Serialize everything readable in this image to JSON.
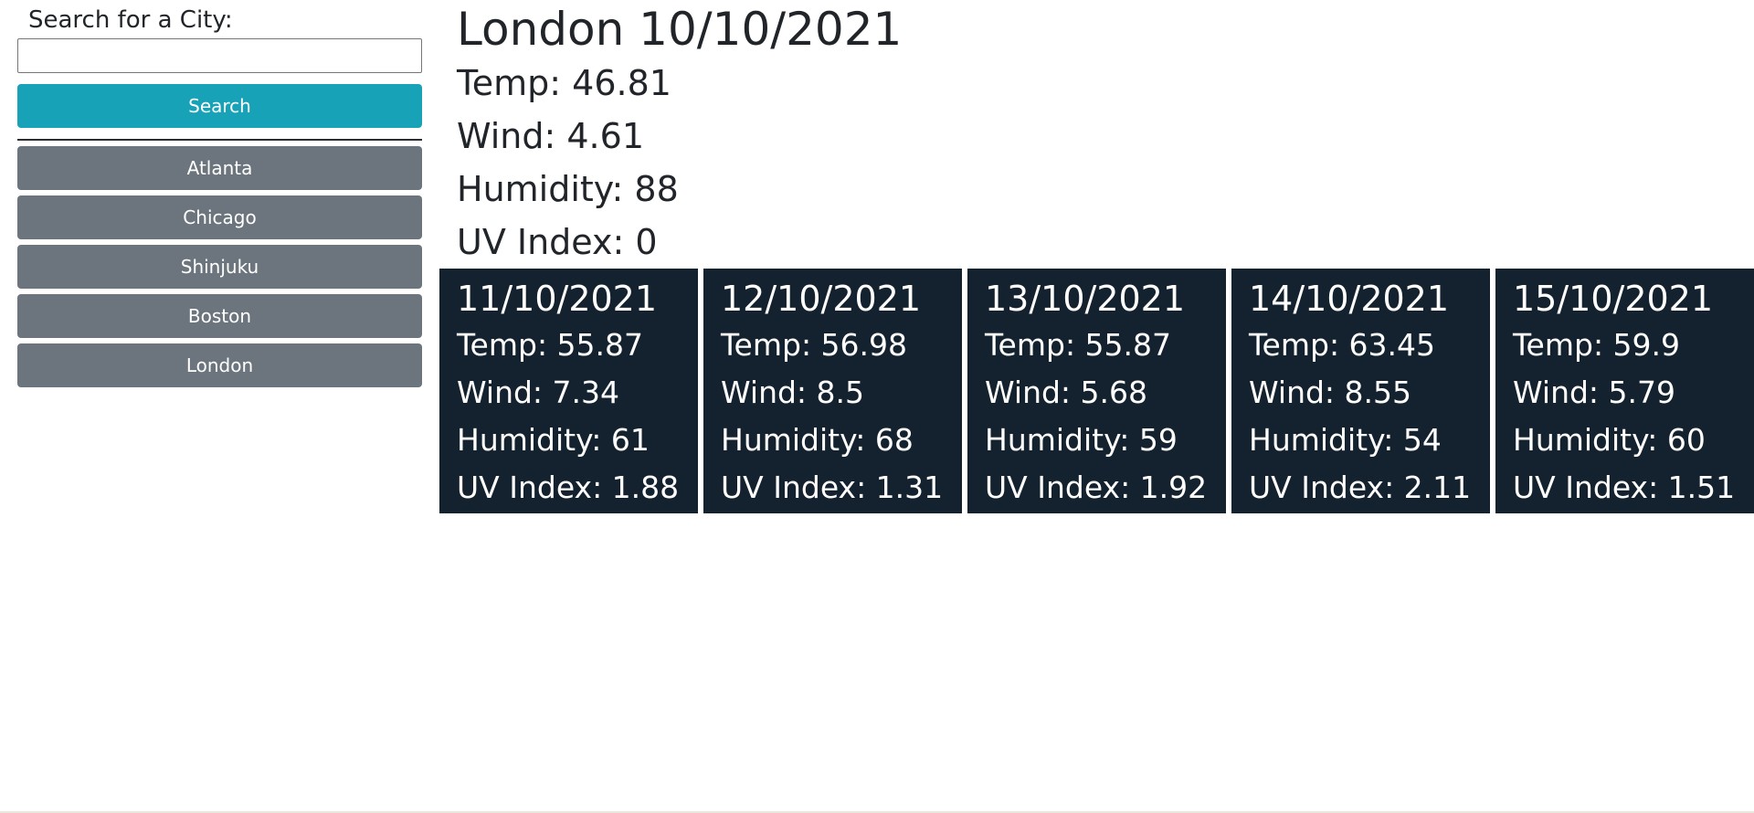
{
  "search": {
    "label": "Search for a City:",
    "placeholder": "",
    "value": "",
    "button_label": "Search"
  },
  "history": [
    "Atlanta",
    "Chicago",
    "Shinjuku",
    "Boston",
    "London"
  ],
  "current": {
    "title": "London 10/10/2021",
    "temp": "Temp: 46.81",
    "wind": "Wind: 4.61",
    "humidity": "Humidity: 88",
    "uv": "UV Index: 0"
  },
  "forecast": [
    {
      "date": "11/10/2021",
      "temp": "Temp: 55.87",
      "wind": "Wind: 7.34",
      "humidity": "Humidity: 61",
      "uv": "UV Index: 1.88"
    },
    {
      "date": "12/10/2021",
      "temp": "Temp: 56.98",
      "wind": "Wind: 8.5",
      "humidity": "Humidity: 68",
      "uv": "UV Index: 1.31"
    },
    {
      "date": "13/10/2021",
      "temp": "Temp: 55.87",
      "wind": "Wind: 5.68",
      "humidity": "Humidity: 59",
      "uv": "UV Index: 1.92"
    },
    {
      "date": "14/10/2021",
      "temp": "Temp: 63.45",
      "wind": "Wind: 8.55",
      "humidity": "Humidity: 54",
      "uv": "UV Index: 2.11"
    },
    {
      "date": "15/10/2021",
      "temp": "Temp: 59.9",
      "wind": "Wind: 5.79",
      "humidity": "Humidity: 60",
      "uv": "UV Index: 1.51"
    }
  ],
  "colors": {
    "search_button": "#17a2b8",
    "city_button": "#6c757d",
    "forecast_card": "#13222e"
  }
}
